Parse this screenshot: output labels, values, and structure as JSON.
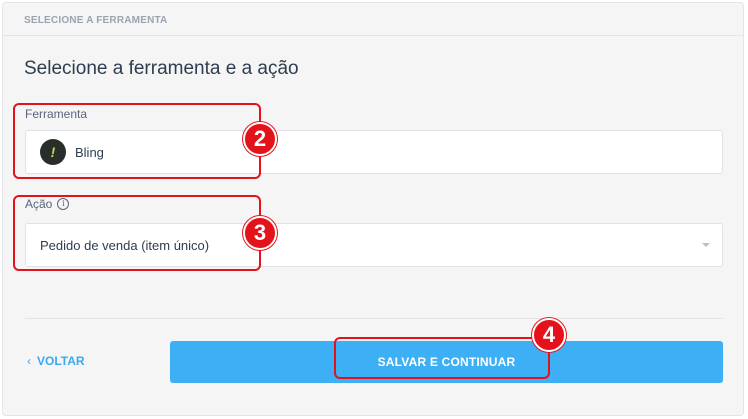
{
  "section": {
    "header": "SELECIONE A FERRAMENTA",
    "title": "Selecione a ferramenta e a ação"
  },
  "tool_field": {
    "label": "Ferramenta",
    "logo_icon": "bling-logo-icon",
    "logo_glyph": "!",
    "value": "Bling"
  },
  "action_field": {
    "label": "Ação",
    "info_icon": "info-icon",
    "info_glyph": "i",
    "value": "Pedido de venda (item único)",
    "dropdown_icon": "chevron-down-icon"
  },
  "footer": {
    "back_chevron": "‹",
    "back_label": "VOLTAR",
    "save_label": "SALVAR E CONTINUAR"
  },
  "annotations": {
    "color": "#e3121b",
    "steps": [
      "2",
      "3",
      "4"
    ]
  },
  "colors": {
    "accent": "#3daff5",
    "link": "#3aa9f0",
    "panel_bg": "#f5f5f5"
  }
}
